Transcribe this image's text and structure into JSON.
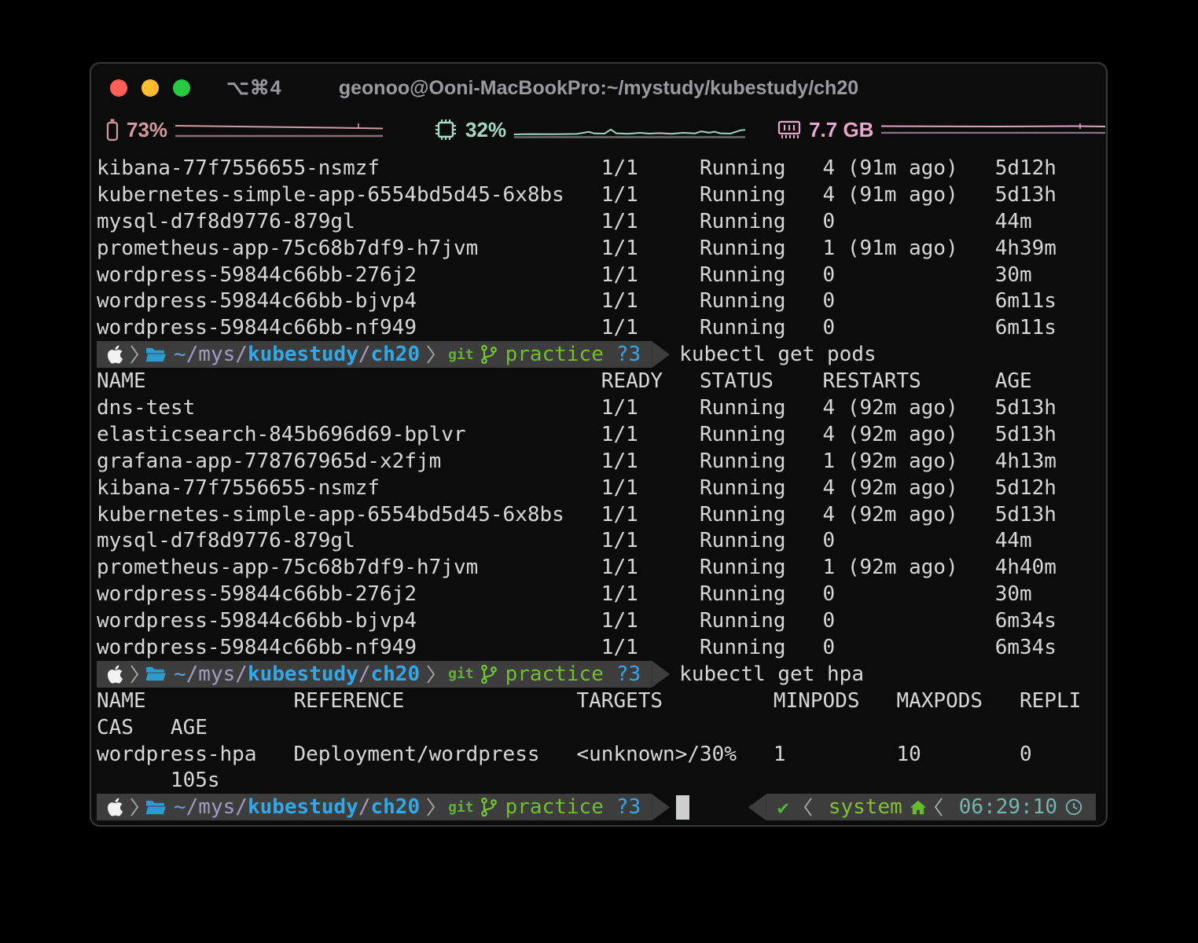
{
  "window": {
    "shortcut": "⌥⌘4",
    "title": "geonoo@Ooni-MacBookPro:~/mystudy/kubestudy/ch20"
  },
  "statusbar": {
    "battery": {
      "percent": "73%"
    },
    "cpu": {
      "percent": "32%"
    },
    "memory": {
      "amount": "7.7 GB"
    }
  },
  "prompt": {
    "dir_home": "~",
    "dir_mid": "/mys/",
    "dir_anchor1": "kubestudy",
    "dir_sep": "/",
    "dir_anchor2": "ch20",
    "git_label": "git",
    "git_branch": "practice",
    "git_counter": "?3"
  },
  "right_status": {
    "ok_indicator": "✔",
    "mode_label": "system",
    "time": "06:29:10"
  },
  "colors": {
    "path_blue": "#2fa9ea",
    "path_dim": "#a39cc2",
    "git_green": "#6fbf2e",
    "counter_blue": "#38a3e6",
    "time_teal": "#74b6b0",
    "battery_pink": "#d59aa0",
    "cpu_teal": "#a5d9c3",
    "memory_pink": "#e7a7c9",
    "segment_gray": "#3d3d3e"
  },
  "terminal": {
    "lines": [
      {
        "type": "row",
        "text": "kibana-77f7556655-nsmzf                  1/1     Running   4 (91m ago)   5d12h"
      },
      {
        "type": "row",
        "text": "kubernetes-simple-app-6554bd5d45-6x8bs   1/1     Running   4 (91m ago)   5d13h"
      },
      {
        "type": "row",
        "text": "mysql-d7f8d9776-879gl                    1/1     Running   0             44m"
      },
      {
        "type": "row",
        "text": "prometheus-app-75c68b7df9-h7jvm          1/1     Running   1 (91m ago)   4h39m"
      },
      {
        "type": "row",
        "text": "wordpress-59844c66bb-276j2               1/1     Running   0             30m"
      },
      {
        "type": "row",
        "text": "wordpress-59844c66bb-bjvp4               1/1     Running   0             6m11s"
      },
      {
        "type": "row",
        "text": "wordpress-59844c66bb-nf949               1/1     Running   0             6m11s"
      },
      {
        "type": "prompt",
        "command": "kubectl get pods"
      },
      {
        "type": "row",
        "text": "NAME                                     READY   STATUS    RESTARTS      AGE"
      },
      {
        "type": "row",
        "text": "dns-test                                 1/1     Running   4 (92m ago)   5d13h"
      },
      {
        "type": "row",
        "text": "elasticsearch-845b696d69-bplvr           1/1     Running   4 (92m ago)   5d13h"
      },
      {
        "type": "row",
        "text": "grafana-app-778767965d-x2fjm             1/1     Running   1 (92m ago)   4h13m"
      },
      {
        "type": "row",
        "text": "kibana-77f7556655-nsmzf                  1/1     Running   4 (92m ago)   5d12h"
      },
      {
        "type": "row",
        "text": "kubernetes-simple-app-6554bd5d45-6x8bs   1/1     Running   4 (92m ago)   5d13h"
      },
      {
        "type": "row",
        "text": "mysql-d7f8d9776-879gl                    1/1     Running   0             44m"
      },
      {
        "type": "row",
        "text": "prometheus-app-75c68b7df9-h7jvm          1/1     Running   1 (92m ago)   4h40m"
      },
      {
        "type": "row",
        "text": "wordpress-59844c66bb-276j2               1/1     Running   0             30m"
      },
      {
        "type": "row",
        "text": "wordpress-59844c66bb-bjvp4               1/1     Running   0             6m34s"
      },
      {
        "type": "row",
        "text": "wordpress-59844c66bb-nf949               1/1     Running   0             6m34s"
      },
      {
        "type": "prompt",
        "command": "kubectl get hpa"
      },
      {
        "type": "row",
        "text": "NAME            REFERENCE              TARGETS         MINPODS   MAXPODS   REPLI"
      },
      {
        "type": "row",
        "text": "CAS   AGE"
      },
      {
        "type": "row",
        "text": "wordpress-hpa   Deployment/wordpress   <unknown>/30%   1         10        0"
      },
      {
        "type": "row",
        "text": "      105s"
      },
      {
        "type": "prompt",
        "cursor": true
      }
    ]
  }
}
